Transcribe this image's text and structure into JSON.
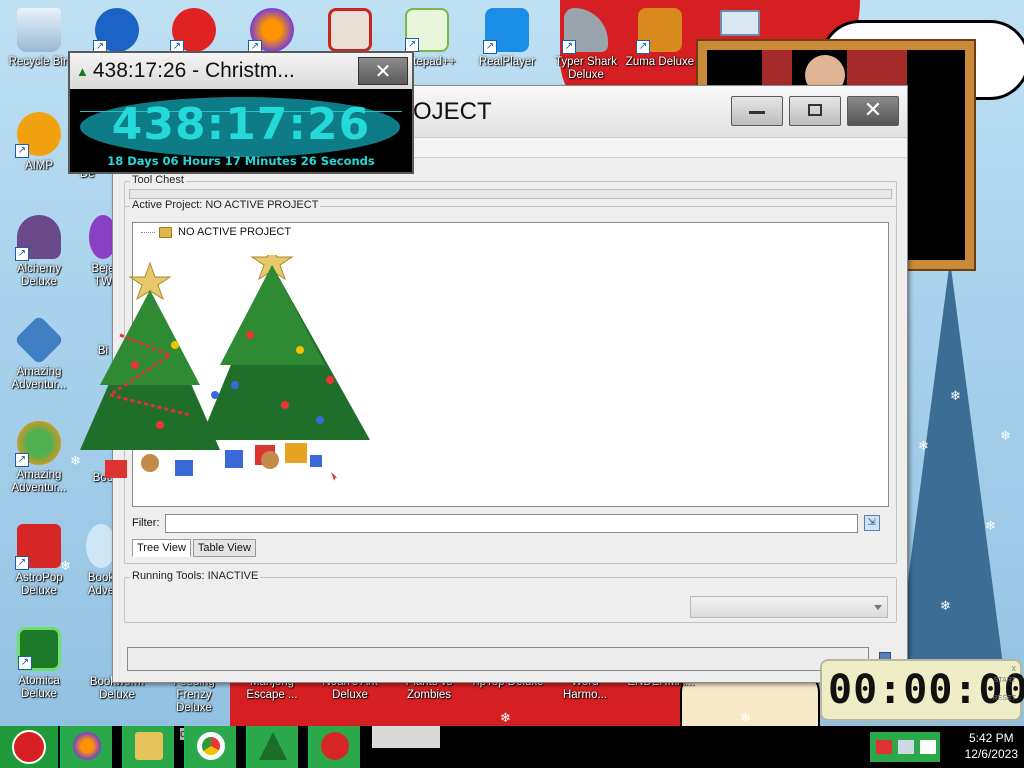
{
  "desktop": {
    "icons": [
      {
        "label": "Recycle Bin",
        "name": "recycle-bin-icon"
      },
      {
        "label": "",
        "name": "app-icon-2"
      },
      {
        "label": "",
        "name": "app-icon-red-creature"
      },
      {
        "label": "",
        "name": "firefox-icon"
      },
      {
        "label": "",
        "name": "app-icon-gate"
      },
      {
        "label": "Notepad++",
        "name": "notepad-plus-plus-icon"
      },
      {
        "label": "RealPlayer",
        "name": "realplayer-icon"
      },
      {
        "label": "Typer Shark Deluxe",
        "name": "typer-shark-icon"
      },
      {
        "label": "Zuma Deluxe",
        "name": "zuma-icon"
      },
      {
        "label": "AIMP",
        "name": "aimp-icon"
      },
      {
        "label": "Alchemy Deluxe",
        "name": "alchemy-icon"
      },
      {
        "label": "Amazing Adventur...",
        "name": "amazing-adventures-icon"
      },
      {
        "label": "Amazing Adventur...",
        "name": "amazing-adventures-2-icon"
      },
      {
        "label": "AstroPop Deluxe",
        "name": "astropop-icon"
      },
      {
        "label": "Atomica Deluxe",
        "name": "atomica-icon"
      },
      {
        "label": "Bookworm Deluxe",
        "name": "bookworm-icon"
      },
      {
        "label": "Feeding Frenzy Deluxe",
        "name": "feeding-frenzy-icon"
      },
      {
        "label": "Mahjong Escape ...",
        "name": "mahjong-icon"
      },
      {
        "label": "Noah's Ark Deluxe",
        "name": "noahs-ark-icon"
      },
      {
        "label": "Plants vs Zombies",
        "name": "plants-vs-zombies-icon"
      },
      {
        "label": "TipTop Deluxe",
        "name": "tiptop-icon"
      },
      {
        "label": "Word Harmo...",
        "name": "word-harmony-icon"
      },
      {
        "label": "ENDERMA...",
        "name": "enderman-icon"
      }
    ],
    "partial_labels": {
      "bejeweled": "Beje TW",
      "book": "Boo",
      "book_adv": "Book Adve",
      "de": "De",
      "bi": "Bi"
    }
  },
  "countdown": {
    "title": "438:17:26 - Christm...",
    "time": "438:17:26",
    "subtitle": "18 Days 06 Hours 17 Minutes 26 Seconds",
    "close_label": "✕",
    "accent": "#23d9d9"
  },
  "main_window": {
    "title": "OJECT",
    "close_label": "✕",
    "tool_chest_label": "Tool Chest",
    "active_project_label": "Active Project: NO ACTIVE PROJECT",
    "tree_root": "NO ACTIVE PROJECT",
    "filter_label": "Filter:",
    "filter_value": "",
    "tabs": [
      {
        "label": "Tree View",
        "active": true
      },
      {
        "label": "Table View",
        "active": false
      }
    ],
    "running_tools_label": "Running Tools: INACTIVE",
    "running_select_value": ""
  },
  "stopwatch": {
    "time": "00:00:00",
    "start_label": "START",
    "reset_label": "RESET",
    "close_label": "x"
  },
  "taskbar": {
    "items": [
      {
        "name": "firefox-taskbar",
        "label": ""
      },
      {
        "name": "file-explorer-taskbar",
        "label": ""
      },
      {
        "name": "chrome-taskbar",
        "label": ""
      },
      {
        "name": "christmas-tree-taskbar",
        "label": ""
      },
      {
        "name": "app-taskbar-red",
        "label": ""
      }
    ],
    "partial_labels": [
      "anty",
      "ownloads"
    ],
    "clock_time": "5:42 PM",
    "clock_date": "12/6/2023"
  },
  "colors": {
    "desktop_bg": "#a8d2ec",
    "accent_red": "#d51f22",
    "taskbar_green": "#2aa84a"
  }
}
